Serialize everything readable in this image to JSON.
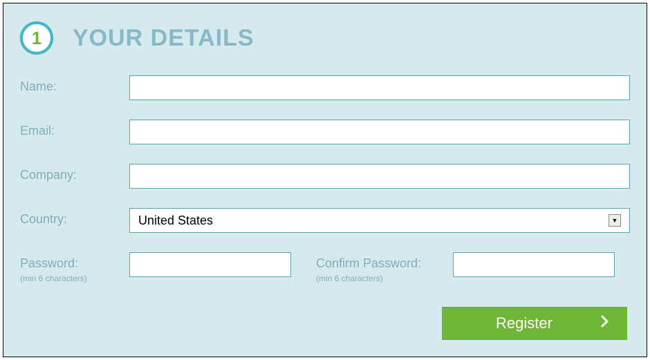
{
  "header": {
    "step_number": "1",
    "title": "YOUR DETAILS"
  },
  "form": {
    "name_label": "Name:",
    "name_value": "",
    "email_label": "Email:",
    "email_value": "",
    "company_label": "Company:",
    "company_value": "",
    "country_label": "Country:",
    "country_value": "United States",
    "password_label": "Password:",
    "password_hint": "(min 6 characters)",
    "password_value": "",
    "confirm_label": "Confirm Password:",
    "confirm_hint": "(min 6 characters)",
    "confirm_value": ""
  },
  "actions": {
    "register_label": "Register"
  }
}
